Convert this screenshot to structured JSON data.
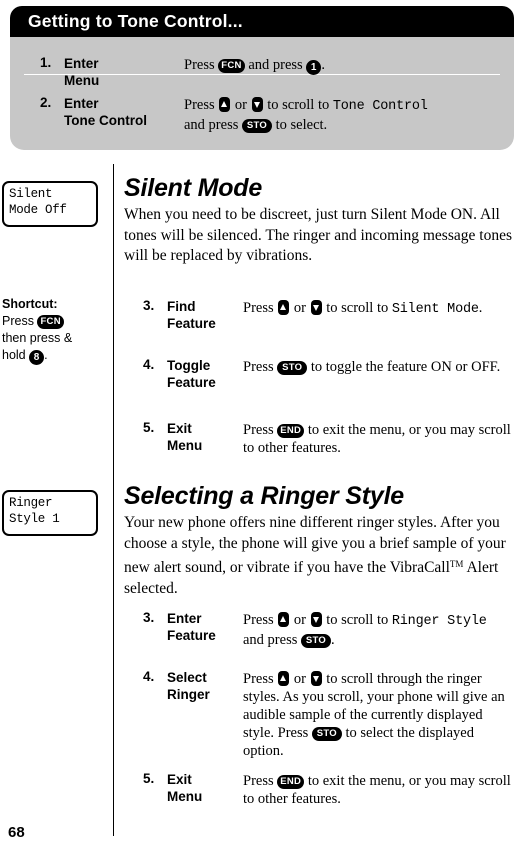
{
  "page": {
    "number": "68"
  },
  "top_panel": {
    "title": "Getting to Tone Control...",
    "steps": [
      {
        "num": "1.",
        "label": "Enter Menu",
        "text_1": "Press",
        "key_1": "FCN",
        "text_2": "and press",
        "key_2": "1",
        "text_3": "."
      },
      {
        "num": "2.",
        "label_line1": "Enter",
        "label_line2": "Tone Control",
        "text_1": "Press",
        "text_2": "or",
        "text_3": "to scroll to",
        "mono_1": "Tone Control",
        "text_4": "and press",
        "key_1": "STO",
        "text_5": "to select."
      }
    ]
  },
  "silent_mode": {
    "lcd": {
      "line1": "Silent",
      "line2": "Mode Off"
    },
    "heading": "Silent Mode",
    "body": "When you need to be discreet, just turn Silent Mode ON. All tones will be silenced. The ringer and incoming message tones will be replaced by vibrations.",
    "shortcut": {
      "header": "Shortcut:",
      "text_1": "Press",
      "key_1": "FCN",
      "text_2": "then press &",
      "text_3": "hold",
      "key_2": "8",
      "text_4": "."
    },
    "steps": [
      {
        "num": "3.",
        "label_line1": "Find",
        "label_line2": "Feature",
        "text_1": "Press",
        "text_2": "or",
        "text_3": "to scroll to",
        "mono_1": "Silent Mode",
        "text_4": "."
      },
      {
        "num": "4.",
        "label_line1": "Toggle",
        "label_line2": "Feature",
        "text_1": "Press",
        "key_1": "STO",
        "text_2": "to toggle the feature ON or OFF."
      },
      {
        "num": "5.",
        "label_line1": "Exit",
        "label_line2": "Menu",
        "text_1": "Press",
        "key_1": "END",
        "text_2": "to exit the menu, or you may scroll to other features."
      }
    ]
  },
  "ringer_style": {
    "lcd": {
      "line1": "Ringer",
      "line2": "Style 1"
    },
    "heading": "Selecting a Ringer Style",
    "body_part1": "Your new phone offers nine different ringer styles. After you choose a style, the phone will give you a brief sample of your new alert sound, or vibrate if you have the VibraCall",
    "body_tm": "TM",
    "body_part2": " Alert selected.",
    "steps": [
      {
        "num": "3.",
        "label_line1": "Enter",
        "label_line2": "Feature",
        "text_1": "Press",
        "text_2": "or",
        "text_3": "to scroll to",
        "mono_1": "Ringer Style",
        "text_4": "and press",
        "key_1": "STO",
        "text_5": "."
      },
      {
        "num": "4.",
        "label_line1": "Select",
        "label_line2": "Ringer",
        "text_1": "Press",
        "text_2": "or",
        "text_3": "to scroll through the ringer styles. As you scroll, your phone will give an audible sample of the currently displayed style. Press",
        "key_1": "STO",
        "text_4": "to select the displayed option."
      },
      {
        "num": "5.",
        "label_line1": "Exit",
        "label_line2": "Menu",
        "text_1": "Press",
        "key_1": "END",
        "text_2": "to exit the menu, or you may scroll to other features."
      }
    ]
  }
}
